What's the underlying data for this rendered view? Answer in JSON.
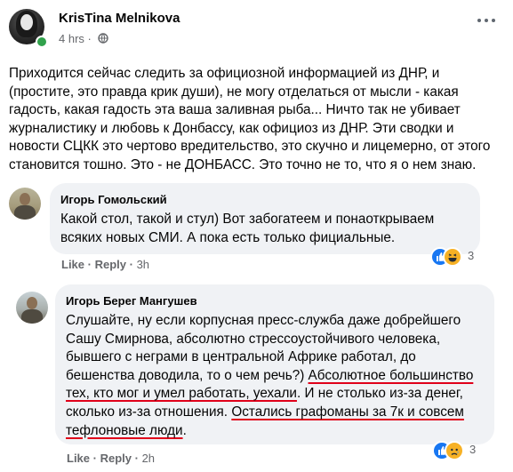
{
  "post": {
    "author": "KrisTina Melnikova",
    "time": "4 hrs",
    "privacy_icon": "globe-icon",
    "text": "Приходится сейчас следить за официозной информацией из ДНР, и (простите, это правда крик души), не могу отделаться от мысли - какая гадость, какая гадость эта ваша заливная рыба... Ничто так не убивает журналистику и любовь к Донбассу, как официоз из ДНР. Эти сводки и новости СЦКК это чертово вредительство, это скучно и лицемерно, от этого становится тошно. Это - не ДОНБАСС. Это точно не то, что я о нем знаю."
  },
  "comments": [
    {
      "author": "Игорь Гомольский",
      "text": "Какой стол, такой и стул) Вот забогатеем и понаоткрываем всяких новых СМИ. А пока есть только фициальные.",
      "like": "Like",
      "reply": "Reply",
      "time": "3h",
      "reactions": [
        "like",
        "haha"
      ],
      "reaction_count": "3"
    },
    {
      "author": "Игорь Берег Мангушев",
      "text_plain": "Слушайте, ну если корпусная пресс-служба даже добрейшего Сашу Смирнова, абсолютно стрессоустойчивого человека, бывшего с неграми в центральной Африке работал, до бешенства доводила, то о чем речь?) ",
      "text_underlined_1": "Абсолютное большинство тех, кто мог и умел работать, уехали",
      "text_mid": ". И не столько из-за денег, сколько из-за отношения. ",
      "text_underlined_2": "Остались графоманы за 7к и совсем тефлоновые люди",
      "text_end": ".",
      "like": "Like",
      "reply": "Reply",
      "time": "2h",
      "reactions": [
        "like",
        "sad"
      ],
      "reaction_count": "3"
    }
  ],
  "colors": {
    "secondary_text": "#65676b",
    "bubble_bg": "#f0f2f5",
    "like_blue": "#1877f2",
    "emoji_yellow": "#f7b125",
    "online_green": "#31a24c",
    "underline_red": "#e0001a"
  }
}
